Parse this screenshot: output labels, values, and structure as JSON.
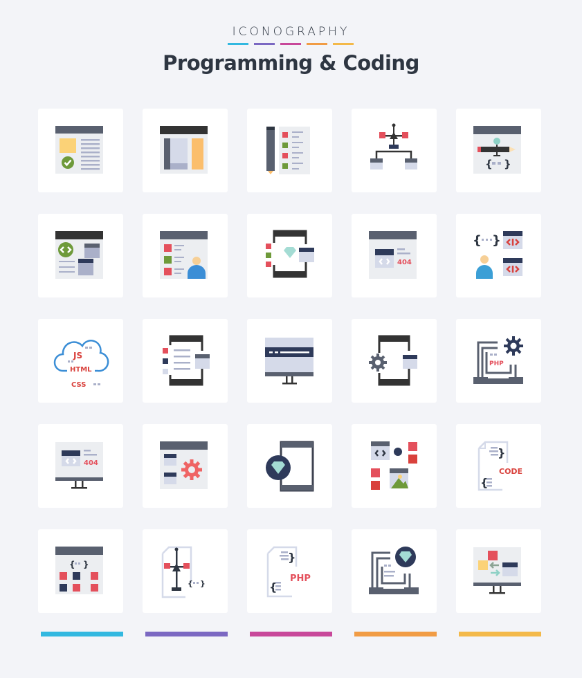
{
  "header": {
    "brand": "ICONOGRAPHY",
    "title": "Programming & Coding",
    "stripe_colors": [
      "#32b8e0",
      "#7b68c2",
      "#c8489a",
      "#f19c45",
      "#f3b94a"
    ]
  },
  "icons": [
    {
      "name": "web-page-approved-icon"
    },
    {
      "name": "web-layout-icon"
    },
    {
      "name": "pencil-checklist-icon"
    },
    {
      "name": "code-hierarchy-icon"
    },
    {
      "name": "web-design-code-icon"
    },
    {
      "name": "browser-code-windows-icon"
    },
    {
      "name": "browser-user-list-icon"
    },
    {
      "name": "mobile-sketch-icon"
    },
    {
      "name": "browser-404-icon"
    },
    {
      "name": "developer-code-icon"
    },
    {
      "name": "cloud-js-html-css-icon",
      "labels": [
        "JS",
        "HTML",
        "CSS"
      ]
    },
    {
      "name": "mobile-list-code-icon"
    },
    {
      "name": "monitor-browser-icon"
    },
    {
      "name": "mobile-settings-code-icon"
    },
    {
      "name": "laptop-php-settings-icon",
      "labels": [
        "PHP"
      ]
    },
    {
      "name": "monitor-404-icon",
      "labels": [
        "404"
      ]
    },
    {
      "name": "browser-code-settings-icon"
    },
    {
      "name": "mobile-diamond-icon"
    },
    {
      "name": "code-image-blocks-icon"
    },
    {
      "name": "code-file-icon",
      "labels": [
        "CODE"
      ]
    },
    {
      "name": "browser-blocks-icon"
    },
    {
      "name": "file-vector-code-icon"
    },
    {
      "name": "php-file-icon",
      "labels": [
        "PHP"
      ]
    },
    {
      "name": "laptop-diamond-icon"
    },
    {
      "name": "monitor-transfer-icon"
    }
  ],
  "misc_labels": {
    "error_code": "404"
  },
  "footer": {
    "bar_colors": [
      "#32b8e0",
      "#7b68c2",
      "#c8489a",
      "#f19c45",
      "#f3b94a"
    ]
  }
}
